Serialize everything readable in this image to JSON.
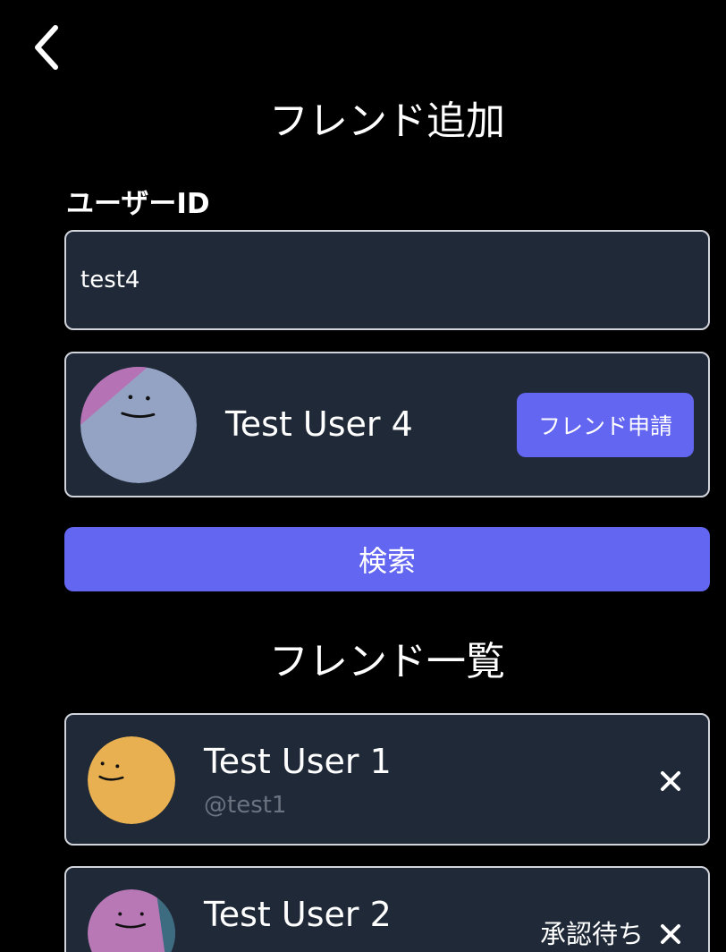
{
  "header": {
    "back_icon": "chevron-left-icon",
    "title": "フレンド追加"
  },
  "search": {
    "label": "ユーザーID",
    "value": "test4",
    "button_label": "検索"
  },
  "result": {
    "name": "Test User 4",
    "request_label": "フレンド申請",
    "avatar_colors": {
      "base": "#94a3c3",
      "accent": "#b572b4"
    }
  },
  "friends": {
    "title": "フレンド一覧",
    "items": [
      {
        "name": "Test User 1",
        "handle": "@test1",
        "status": "",
        "remove_icon": "close-icon",
        "avatar_colors": {
          "base": "#e8b051"
        }
      },
      {
        "name": "Test User 2",
        "status": "承認待ち",
        "remove_icon": "close-icon",
        "avatar_colors": {
          "base": "#b877b5",
          "accent": "#3d6b80"
        }
      }
    ]
  },
  "colors": {
    "background": "#000000",
    "card": "#1f2937",
    "border": "#d1d5db",
    "accent": "#6366f1",
    "muted": "#6b7280"
  }
}
